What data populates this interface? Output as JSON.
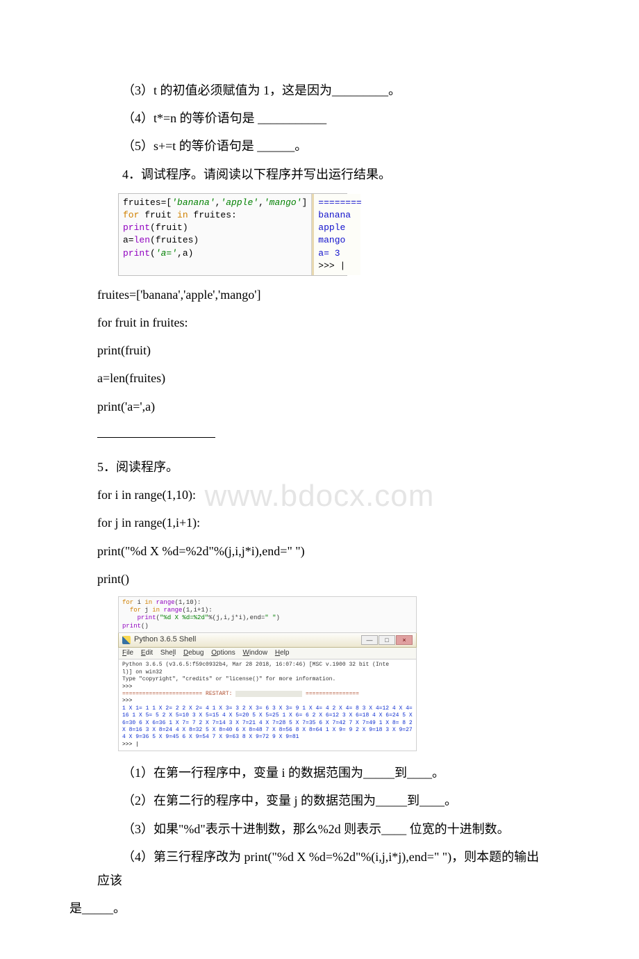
{
  "q3": "（3）t 的初值必须赋值为 1，这是因为_________。",
  "q4": "（4）t*=n 的等价语句是 ___________",
  "q5": "（5）s+=t 的等价语句是 ______。",
  "p4": "4．调试程序。请阅读以下程序并写出运行结果。",
  "code1": {
    "l1a": "fruites=[",
    "l1b": "'banana'",
    "l1c": ",",
    "l1d": "'apple'",
    "l1e": ",",
    "l1f": "'mango'",
    "l1g": "]",
    "l2a": "for",
    "l2b": " fruit ",
    "l2c": "in",
    "l2d": " fruites:",
    "l3a": "  print",
    "l3b": "(fruit)",
    "l4a": "a=",
    "l4b": "len",
    "l4c": "(fruites)",
    "l5a": "print",
    "l5b": "(",
    "l5c": "'a='",
    "l5d": ",a)",
    "out_restart": "========",
    "out1": "banana",
    "out2": "apple",
    "out3": "mango",
    "out4": "a= 3",
    "out5": ">>> |"
  },
  "txt4_1": "fruites=['banana','apple','mango']",
  "txt4_2": "for fruit in fruites:",
  "txt4_3": " print(fruit)",
  "txt4_4": "a=len(fruites)",
  "txt4_5": "print('a=',a)",
  "watermark": "www.bdocx.com",
  "p5": "5．阅读程序。",
  "txt5_1": "for i in range(1,10):",
  "txt5_2": " for j in range(1,i+1):",
  "txt5_3": " print(\"%d X %d=%2d\"%(j,i,j*i),end=\" \")",
  "txt5_4": "print()",
  "code2": {
    "top_l1": "for i in range(1,10):",
    "top_l2": "  for j in range(1,i+1):",
    "top_l3": "    print(\"%d X %d=%2d\"%(j,i,j*i),end=\" \")",
    "top_l4": "print()",
    "title": "Python 3.6.5 Shell",
    "menu": {
      "file": "File",
      "edit": "Edit",
      "shell": "Shell",
      "debug": "Debug",
      "options": "Options",
      "window": "Window",
      "help": "Help"
    },
    "shell_hdr1": "Python 3.6.5 (v3.6.5:f59c0932b4, Mar 28 2018, 16:07:46) [MSC v.1900 32 bit (Inte",
    "shell_hdr1b": "l)] on win32",
    "shell_hdr2": "Type \"copyright\", \"credits\" or \"license()\" for more information.",
    "shell_prompt1": ">>>",
    "shell_restart": "======================== RESTART: ",
    "shell_restart_tail": " ================",
    "shell_prompt2": ">>>",
    "shell_out": "1 X 1= 1 1 X 2= 2 2 X 2= 4 1 X 3= 3 2 X 3= 6 3 X 3= 9 1 X 4= 4 2 X 4= 8 3 X 4=12 4 X 4=16 1 X 5= 5 2 X 5=10 3 X 5=15 4 X 5=20 5 X 5=25 1 X 6= 6 2 X 6=12 3 X 6=18 4 X 6=24 5 X 6=30 6 X 6=36 1 X 7= 7 2 X 7=14 3 X 7=21 4 X 7=28 5 X 7=35 6 X 7=42 7 X 7=49 1 X 8= 8 2 X 8=16 3 X 8=24 4 X 8=32 5 X 8=40 6 X 8=48 7 X 8=56 8 X 8=64 1 X 9= 9 2 X 9=18 3 X 9=27 4 X 9=36 5 X 9=45 6 X 9=54 7 X 9=63 8 X 9=72 9 X 9=81",
    "shell_prompt3": ">>> |"
  },
  "q5_1": "（1）在第一行程序中，变量 i 的数据范围为_____到____。",
  "q5_2": "（2）在第二行的程序中，变量 j 的数据范围为_____到____。",
  "q5_3": "（3）如果\"%d\"表示十进制数，那么%2d 则表示____ 位宽的十进制数。",
  "q5_4a": "（4）第三行程序改为 print(\"%d X %d=%2d\"%(i,j,i*j),end=\" \")，则本题的输出应该",
  "q5_4b": "是_____。"
}
